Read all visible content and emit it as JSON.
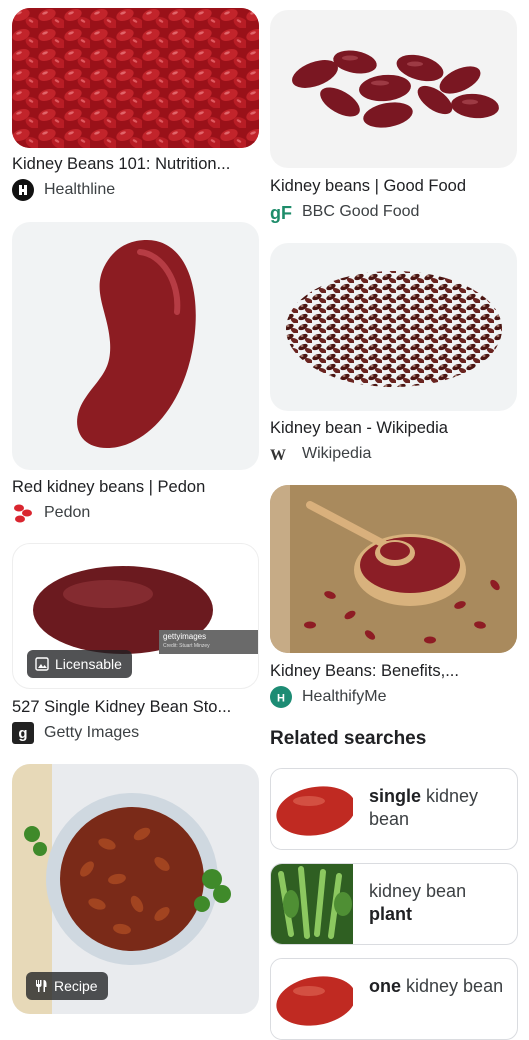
{
  "results": [
    {
      "title": "Kidney Beans 101: Nutrition...",
      "source": "Healthline",
      "favicon": "healthline-icon"
    },
    {
      "title": "Kidney beans | Good Food",
      "source": "BBC Good Food",
      "favicon": "bbc-good-food-icon"
    },
    {
      "title": "Red kidney beans | Pedon",
      "source": "Pedon",
      "favicon": "pedon-icon"
    },
    {
      "title": "Kidney bean - Wikipedia",
      "source": "Wikipedia",
      "favicon": "wikipedia-icon"
    },
    {
      "title": "527 Single Kidney Bean Sto...",
      "source": "Getty Images",
      "favicon": "getty-images-icon",
      "badge": "Licensable",
      "watermark": "gettyimages",
      "credit": "Credit: Stuart Minzey"
    },
    {
      "title": "Kidney Beans: Benefits,...",
      "source": "HealthifyMe",
      "favicon": "healthifyme-icon"
    },
    {
      "title": "",
      "source": "",
      "badge": "Recipe"
    }
  ],
  "related": {
    "heading": "Related searches",
    "items": [
      {
        "bold": "single",
        "rest": " kidney bean"
      },
      {
        "pre": "kidney bean ",
        "bold": "plant"
      },
      {
        "bold": "one",
        "rest": " kidney bean"
      }
    ]
  },
  "colors": {
    "bean_red": "#8e1a1f",
    "text": "#202124",
    "border": "#dadce0"
  }
}
